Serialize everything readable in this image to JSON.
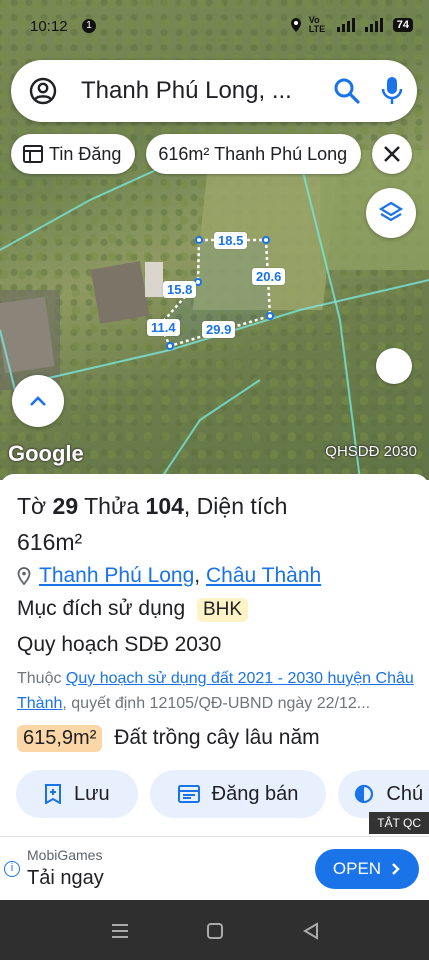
{
  "status_bar": {
    "time": "10:12",
    "notif_count": "1",
    "net": "Vo LTE",
    "battery": "74"
  },
  "search": {
    "query": "Thanh Phú Long, ..."
  },
  "chips": [
    {
      "label": "Tin Đăng"
    },
    {
      "label": "616m² Thanh Phú Long"
    }
  ],
  "map": {
    "brand": "Google",
    "layer_label": "QHSDĐ 2030",
    "edge_lengths": [
      "18.5",
      "20.6",
      "15.8",
      "11.4",
      "29.9"
    ]
  },
  "parcel": {
    "to_label": "Tờ",
    "to_value": "29",
    "thua_label": "Thửa",
    "thua_value": "104",
    "area_label": ", Diện tích",
    "area_value": "616m²",
    "location": [
      "Thanh Phú Long",
      "Châu Thành"
    ],
    "purpose_label": "Mục đích sử dụng",
    "purpose_code": "BHK",
    "plan_label": "Quy hoạch SDĐ 2030",
    "plan_prefix": "Thuộc ",
    "plan_link": "Quy hoạch sử dụng đất 2021 - 2030 huyện Châu Thành",
    "plan_suffix": ", quyết định 12105/QĐ-UBND ngày 22/12...",
    "land_area": "615,9m²",
    "land_type": "Đất trồng cây lâu năm"
  },
  "actions": [
    {
      "label": "Lưu"
    },
    {
      "label": "Đăng bán"
    },
    {
      "label": "Chú t"
    }
  ],
  "ad": {
    "close_label": "TẮT QC",
    "advertiser": "MobiGames",
    "cta_text": "Tải ngay",
    "button_label": "OPEN"
  }
}
